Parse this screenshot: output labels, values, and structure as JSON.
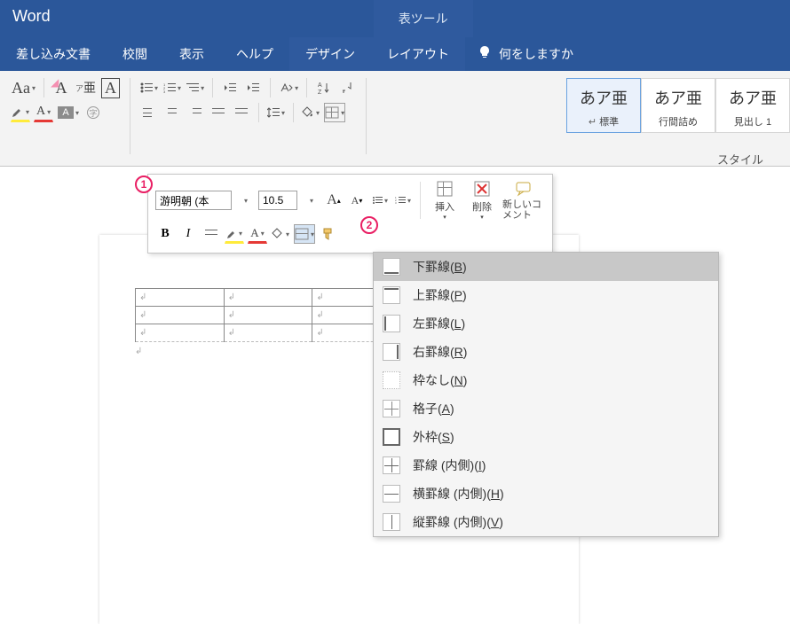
{
  "app": {
    "title": "Word"
  },
  "titlebar": {
    "context_title": "表ツール"
  },
  "tabs": [
    {
      "label": "差し込み文書"
    },
    {
      "label": "校閲"
    },
    {
      "label": "表示"
    },
    {
      "label": "ヘルプ"
    },
    {
      "label": "デザイン",
      "context": true
    },
    {
      "label": "レイアウト",
      "context": true
    }
  ],
  "tellme": {
    "text": "何をしますか"
  },
  "styles": {
    "label": "スタイル",
    "items": [
      {
        "sample": "あア亜",
        "name": "標準"
      },
      {
        "sample": "あア亜",
        "name": "行間詰め"
      },
      {
        "sample": "あア亜",
        "name": "見出し 1"
      }
    ]
  },
  "mini": {
    "font_name": "游明朝 (本",
    "font_size": "10.5",
    "insert": "挿入",
    "delete": "削除",
    "comment": "新しいコメント"
  },
  "border_menu": {
    "items": [
      {
        "label": "下罫線",
        "key": "B",
        "icon": "bottom",
        "hover": true
      },
      {
        "label": "上罫線",
        "key": "P",
        "icon": "top"
      },
      {
        "label": "左罫線",
        "key": "L",
        "icon": "left"
      },
      {
        "label": "右罫線",
        "key": "R",
        "icon": "right"
      },
      {
        "label": "枠なし",
        "key": "N",
        "icon": "none"
      },
      {
        "label": "格子",
        "key": "A",
        "icon": "grid"
      },
      {
        "label": "外枠",
        "key": "S",
        "icon": "outer"
      },
      {
        "label": "罫線 (内側)",
        "key": "I",
        "icon": "inner"
      },
      {
        "label": "横罫線 (内側)",
        "key": "H",
        "icon": "hinner"
      },
      {
        "label": "縦罫線 (内側)",
        "key": "V",
        "icon": "vinner"
      }
    ]
  },
  "annotations": {
    "a1": "1",
    "a2": "2"
  },
  "table": {
    "rows": 3,
    "cols": 3,
    "cell_mark": "↲"
  }
}
